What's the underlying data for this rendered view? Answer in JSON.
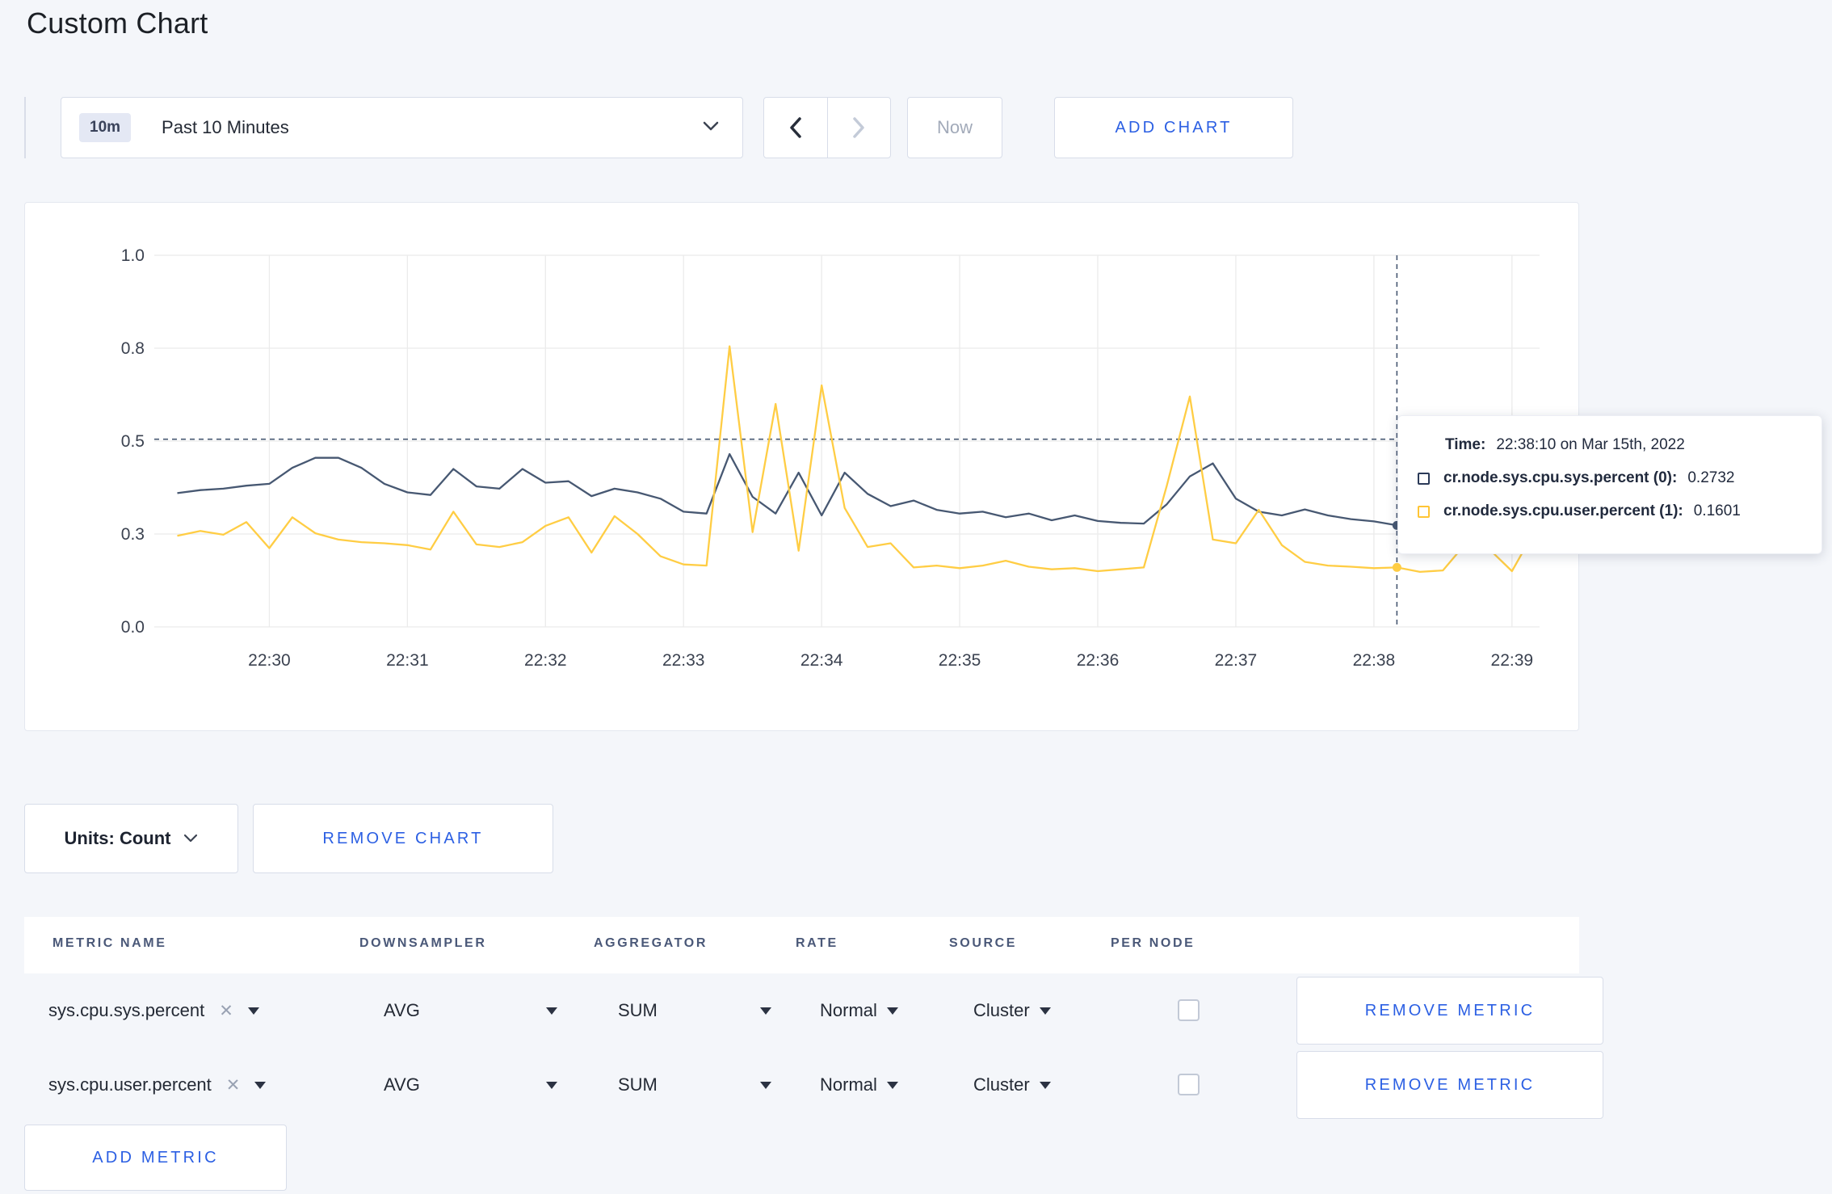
{
  "page_title": "Custom Chart",
  "toolbar": {
    "time_badge": "10m",
    "time_label": "Past 10 Minutes",
    "now_label": "Now",
    "add_chart_label": "ADD CHART"
  },
  "chart_data": {
    "type": "line",
    "title": "",
    "xlabel": "",
    "ylabel": "",
    "ylim": [
      0,
      1
    ],
    "grid": true,
    "legend_position": "tooltip",
    "start_time": "22:29:20",
    "step_seconds": 10,
    "x_ticks": [
      "22:30",
      "22:31",
      "22:32",
      "22:33",
      "22:34",
      "22:35",
      "22:36",
      "22:37",
      "22:38",
      "22:39"
    ],
    "x_tick_seconds": [
      40,
      100,
      160,
      220,
      280,
      340,
      400,
      460,
      520,
      580
    ],
    "y_tick_labels": [
      "0.0",
      "0.3",
      "0.5",
      "0.8",
      "1.0"
    ],
    "y_tick_values": [
      0,
      0.25,
      0.5,
      0.75,
      1.0
    ],
    "series": [
      {
        "name": "cr.node.sys.cpu.sys.percent",
        "color": "#475872",
        "values": [
          0.36,
          0.368,
          0.372,
          0.38,
          0.385,
          0.428,
          0.455,
          0.455,
          0.428,
          0.385,
          0.362,
          0.355,
          0.425,
          0.378,
          0.372,
          0.425,
          0.388,
          0.392,
          0.352,
          0.372,
          0.362,
          0.345,
          0.31,
          0.305,
          0.465,
          0.35,
          0.305,
          0.415,
          0.3,
          0.415,
          0.358,
          0.325,
          0.34,
          0.315,
          0.305,
          0.31,
          0.295,
          0.305,
          0.287,
          0.3,
          0.285,
          0.28,
          0.278,
          0.33,
          0.405,
          0.44,
          0.345,
          0.31,
          0.3,
          0.316,
          0.3,
          0.29,
          0.284,
          0.2732,
          0.3,
          0.31,
          0.3,
          0.31,
          0.3,
          0.31
        ]
      },
      {
        "name": "cr.node.sys.cpu.user.percent",
        "color": "#FFCD44",
        "values": [
          0.245,
          0.258,
          0.248,
          0.282,
          0.212,
          0.295,
          0.252,
          0.235,
          0.228,
          0.225,
          0.22,
          0.208,
          0.31,
          0.222,
          0.215,
          0.228,
          0.272,
          0.295,
          0.2,
          0.298,
          0.25,
          0.19,
          0.168,
          0.165,
          0.755,
          0.255,
          0.6,
          0.205,
          0.65,
          0.32,
          0.215,
          0.225,
          0.16,
          0.165,
          0.158,
          0.165,
          0.178,
          0.162,
          0.155,
          0.158,
          0.15,
          0.155,
          0.16,
          0.38,
          0.62,
          0.235,
          0.225,
          0.315,
          0.22,
          0.175,
          0.165,
          0.162,
          0.158,
          0.1601,
          0.148,
          0.152,
          0.225,
          0.21,
          0.15,
          0.26
        ]
      }
    ],
    "crosshair": {
      "t_seconds": 530,
      "hline_value": 0.505,
      "color": "#475872"
    }
  },
  "tooltip": {
    "time_label": "Time:",
    "time_value": "22:38:10 on Mar 15th, 2022",
    "series": [
      {
        "label": "cr.node.sys.cpu.sys.percent (0):",
        "value": "0.2732",
        "color": "#2b3a58"
      },
      {
        "label": "cr.node.sys.cpu.user.percent (1):",
        "value": "0.1601",
        "color": "#ffc535"
      }
    ]
  },
  "chart_controls": {
    "units_label": "Units: Count",
    "remove_chart_label": "REMOVE CHART"
  },
  "metrics_table": {
    "headers": [
      "METRIC NAME",
      "DOWNSAMPLER",
      "AGGREGATOR",
      "RATE",
      "SOURCE",
      "PER NODE"
    ],
    "rows": [
      {
        "metric": "sys.cpu.sys.percent",
        "clear": "✕",
        "downsampler": "AVG",
        "aggregator": "SUM",
        "rate": "Normal",
        "source": "Cluster",
        "per_node_checked": false,
        "remove_label": "REMOVE METRIC"
      },
      {
        "metric": "sys.cpu.user.percent",
        "clear": "✕",
        "downsampler": "AVG",
        "aggregator": "SUM",
        "rate": "Normal",
        "source": "Cluster",
        "per_node_checked": false,
        "remove_label": "REMOVE METRIC"
      }
    ],
    "add_metric_label": "ADD METRIC"
  }
}
